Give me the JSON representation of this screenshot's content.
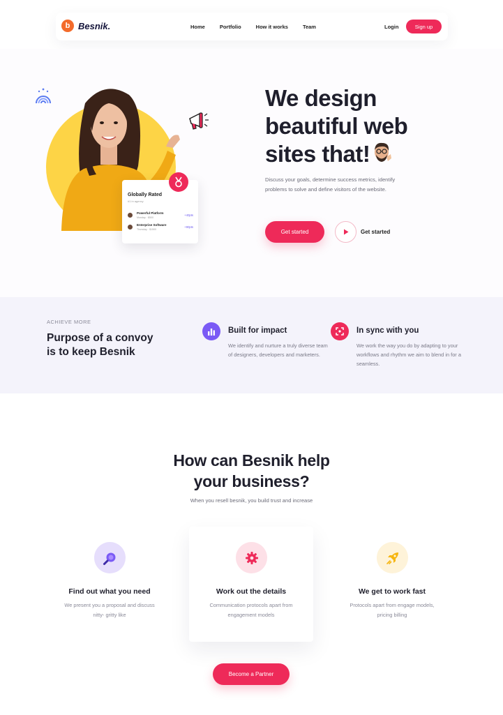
{
  "nav": {
    "logo_letter": "b",
    "logo_text": "Besnik.",
    "links": [
      "Home",
      "Portfolio",
      "How it works",
      "Team"
    ],
    "login": "Login",
    "signup": "Sign up"
  },
  "hero": {
    "title_line1": "We design",
    "title_line2": "beautiful web",
    "title_line3": "sites that!",
    "description": "Discuss your goals, determine success metrics, identify problems to solve and define visitors of the website.",
    "cta_primary": "Get started",
    "cta_secondary": "Get started",
    "rated_card": {
      "title": "Globally Rated",
      "subtitle": "#1 in agency",
      "rows": [
        {
          "name": "Powerful Platform",
          "meta": "Monday · $500",
          "points": "+40pts"
        },
        {
          "name": "Enterprise Software",
          "meta": "Thursday · $1500",
          "points": "+90pts"
        }
      ]
    }
  },
  "achieve": {
    "eyebrow": "ACHIEVE MORE",
    "title": "Purpose of a convoy is to keep Besnik",
    "features": [
      {
        "title": "Built for impact",
        "text": "We identify and nurture a truly diverse team of designers, developers and marketers.",
        "icon": "chart-icon",
        "color": "#7a5af5"
      },
      {
        "title": "In sync with you",
        "text": "We work the way you do by adapting to your workflows and rhythm we aim to blend in for a seamless.",
        "icon": "sync-icon",
        "color": "#ee2a59"
      }
    ]
  },
  "how": {
    "title_line1": "How can Besnik help",
    "title_line2": "your business?",
    "subtitle": "When you resell besnik, you build trust and increase",
    "services": [
      {
        "title": "Find out what you need",
        "text": "We present you a proposal and discuss nitty- gritty like",
        "icon": "search-icon"
      },
      {
        "title": "Work out the details",
        "text": "Communication protocols apart from engagement models",
        "icon": "gear-icon"
      },
      {
        "title": "We get to work fast",
        "text": "Protocols apart from engage models, pricing billing",
        "icon": "rocket-icon"
      }
    ],
    "cta": "Become a Partner"
  },
  "colors": {
    "accent": "#ee2a59",
    "brand_orange": "#f36b2b",
    "purple": "#7a5af5",
    "yellow": "#fdd446"
  }
}
